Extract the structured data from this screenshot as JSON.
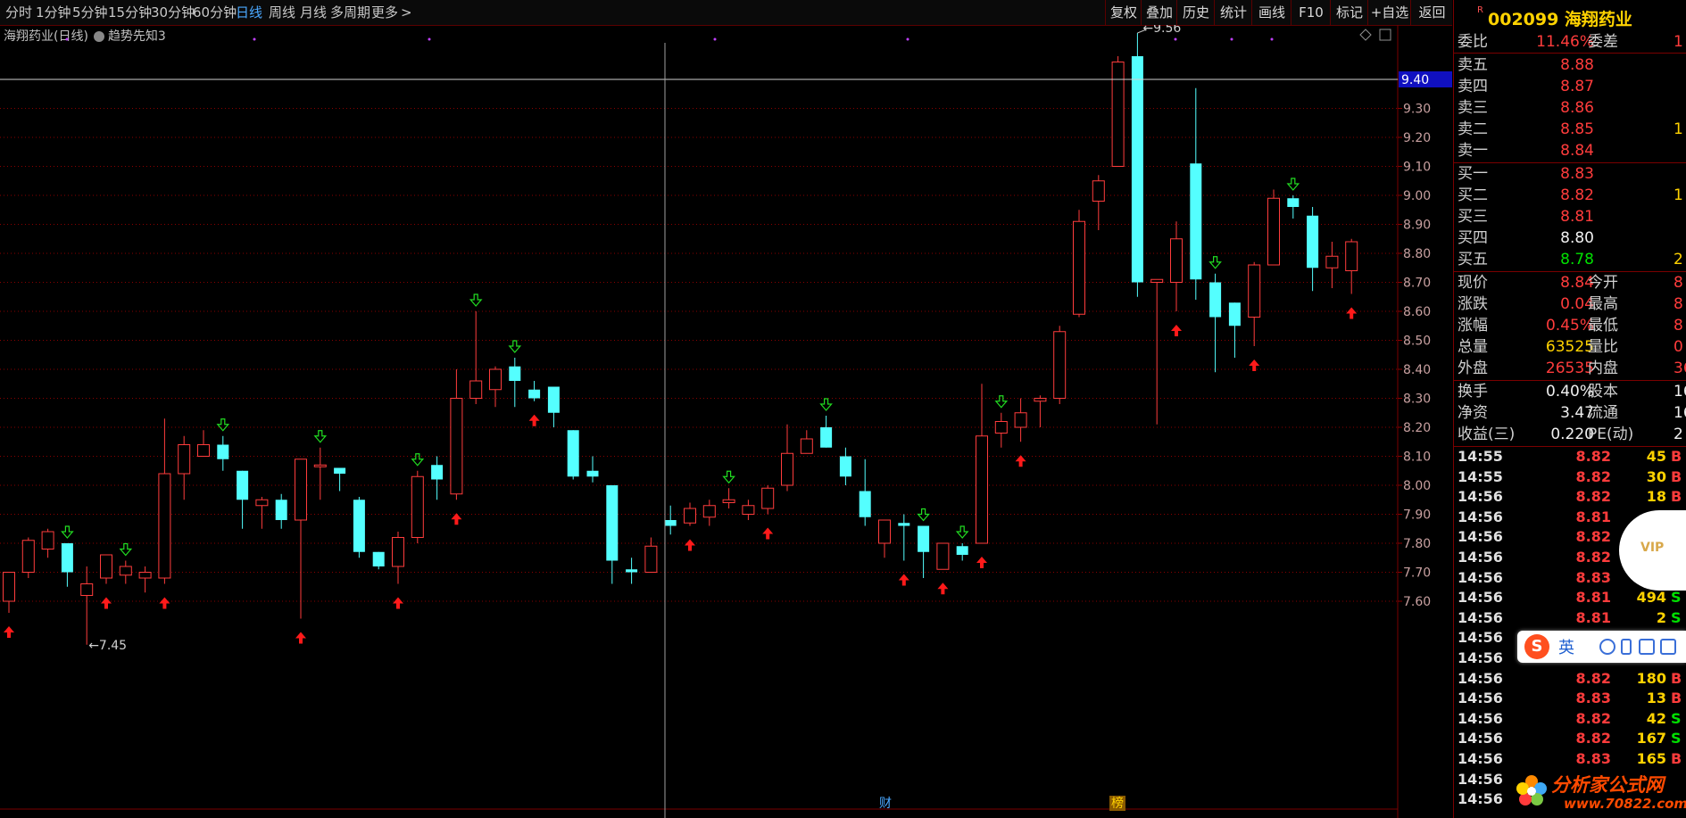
{
  "toolbar": {
    "periods": [
      "分时",
      "1分钟",
      "5分钟",
      "15分钟",
      "30分钟",
      "60分钟",
      "日线",
      "周线",
      "月线",
      "多周期",
      "更多"
    ],
    "active_period": "日线",
    "more_arrow": ">",
    "right_buttons": [
      "复权",
      "叠加",
      "历史",
      "统计",
      "画线",
      "F10",
      "标记",
      "+自选",
      "返回"
    ]
  },
  "chart": {
    "stock_title": "海翔药业(日线)",
    "indicator": "趋势先知3",
    "crosshair_price": "9.40",
    "high_label": "9.56",
    "low_label": "7.45",
    "markers": [
      "财",
      "榜"
    ],
    "icons": [
      "diamond-icon",
      "window-icon"
    ]
  },
  "chart_data": {
    "type": "candlestick",
    "y_ticks": [
      "9.40",
      "9.30",
      "9.20",
      "9.10",
      "9.00",
      "8.90",
      "8.80",
      "8.70",
      "8.60",
      "8.50",
      "8.40",
      "8.30",
      "8.20",
      "8.10",
      "8.00",
      "7.90",
      "7.80",
      "7.70",
      "7.60"
    ],
    "ylim": [
      7.4,
      9.6
    ],
    "up_color": "#ff3c3c",
    "down_color": "#54ffff",
    "candles": [
      {
        "o": 7.6,
        "h": 7.7,
        "l": 7.56,
        "c": 7.7
      },
      {
        "o": 7.7,
        "h": 7.82,
        "l": 7.68,
        "c": 7.81
      },
      {
        "o": 7.78,
        "h": 7.85,
        "l": 7.75,
        "c": 7.84
      },
      {
        "o": 7.8,
        "h": 7.8,
        "l": 7.65,
        "c": 7.7
      },
      {
        "o": 7.62,
        "h": 7.72,
        "l": 7.45,
        "c": 7.66
      },
      {
        "o": 7.68,
        "h": 7.76,
        "l": 7.66,
        "c": 7.76
      },
      {
        "o": 7.69,
        "h": 7.74,
        "l": 7.66,
        "c": 7.72
      },
      {
        "o": 7.68,
        "h": 7.72,
        "l": 7.63,
        "c": 7.7
      },
      {
        "o": 7.68,
        "h": 8.23,
        "l": 7.66,
        "c": 8.04
      },
      {
        "o": 8.04,
        "h": 8.17,
        "l": 7.95,
        "c": 8.14
      },
      {
        "o": 8.1,
        "h": 8.19,
        "l": 8.1,
        "c": 8.14
      },
      {
        "o": 8.14,
        "h": 8.17,
        "l": 8.05,
        "c": 8.09
      },
      {
        "o": 8.05,
        "h": 8.05,
        "l": 7.85,
        "c": 7.95
      },
      {
        "o": 7.93,
        "h": 7.96,
        "l": 7.85,
        "c": 7.95
      },
      {
        "o": 7.95,
        "h": 7.97,
        "l": 7.85,
        "c": 7.88
      },
      {
        "o": 7.88,
        "h": 8.09,
        "l": 7.54,
        "c": 8.09
      },
      {
        "o": 8.07,
        "h": 8.13,
        "l": 7.95,
        "c": 8.07
      },
      {
        "o": 8.06,
        "h": 8.06,
        "l": 7.98,
        "c": 8.04
      },
      {
        "o": 7.95,
        "h": 7.96,
        "l": 7.75,
        "c": 7.77
      },
      {
        "o": 7.77,
        "h": 7.77,
        "l": 7.71,
        "c": 7.72
      },
      {
        "o": 7.72,
        "h": 7.84,
        "l": 7.66,
        "c": 7.82
      },
      {
        "o": 7.82,
        "h": 8.05,
        "l": 7.8,
        "c": 8.03
      },
      {
        "o": 8.07,
        "h": 8.1,
        "l": 7.95,
        "c": 8.02
      },
      {
        "o": 7.97,
        "h": 8.4,
        "l": 7.95,
        "c": 8.3
      },
      {
        "o": 8.3,
        "h": 8.6,
        "l": 8.28,
        "c": 8.36
      },
      {
        "o": 8.33,
        "h": 8.41,
        "l": 8.27,
        "c": 8.4
      },
      {
        "o": 8.41,
        "h": 8.44,
        "l": 8.27,
        "c": 8.36
      },
      {
        "o": 8.33,
        "h": 8.36,
        "l": 8.29,
        "c": 8.3
      },
      {
        "o": 8.34,
        "h": 8.34,
        "l": 8.2,
        "c": 8.25
      },
      {
        "o": 8.19,
        "h": 8.19,
        "l": 8.02,
        "c": 8.03
      },
      {
        "o": 8.05,
        "h": 8.1,
        "l": 8.01,
        "c": 8.03
      },
      {
        "o": 8.0,
        "h": 8.0,
        "l": 7.66,
        "c": 7.74
      },
      {
        "o": 7.71,
        "h": 7.75,
        "l": 7.66,
        "c": 7.7
      },
      {
        "o": 7.7,
        "h": 7.82,
        "l": 7.7,
        "c": 7.79
      },
      {
        "o": 7.88,
        "h": 7.93,
        "l": 7.83,
        "c": 7.86
      },
      {
        "o": 7.87,
        "h": 7.94,
        "l": 7.86,
        "c": 7.92
      },
      {
        "o": 7.89,
        "h": 7.95,
        "l": 7.86,
        "c": 7.93
      },
      {
        "o": 7.94,
        "h": 7.99,
        "l": 7.92,
        "c": 7.95
      },
      {
        "o": 7.9,
        "h": 7.95,
        "l": 7.88,
        "c": 7.93
      },
      {
        "o": 7.92,
        "h": 8.0,
        "l": 7.9,
        "c": 7.99
      },
      {
        "o": 8.0,
        "h": 8.21,
        "l": 7.98,
        "c": 8.11
      },
      {
        "o": 8.11,
        "h": 8.19,
        "l": 8.13,
        "c": 8.16
      },
      {
        "o": 8.2,
        "h": 8.24,
        "l": 8.13,
        "c": 8.13
      },
      {
        "o": 8.1,
        "h": 8.13,
        "l": 8.0,
        "c": 8.03
      },
      {
        "o": 7.98,
        "h": 8.09,
        "l": 7.86,
        "c": 7.89
      },
      {
        "o": 7.8,
        "h": 7.88,
        "l": 7.75,
        "c": 7.88
      },
      {
        "o": 7.87,
        "h": 7.9,
        "l": 7.74,
        "c": 7.86
      },
      {
        "o": 7.86,
        "h": 7.86,
        "l": 7.68,
        "c": 7.77
      },
      {
        "o": 7.71,
        "h": 7.8,
        "l": 7.71,
        "c": 7.8
      },
      {
        "o": 7.79,
        "h": 7.8,
        "l": 7.74,
        "c": 7.76
      },
      {
        "o": 7.8,
        "h": 8.35,
        "l": 7.8,
        "c": 8.17
      },
      {
        "o": 8.18,
        "h": 8.25,
        "l": 8.13,
        "c": 8.22
      },
      {
        "o": 8.2,
        "h": 8.3,
        "l": 8.15,
        "c": 8.25
      },
      {
        "o": 8.29,
        "h": 8.31,
        "l": 8.2,
        "c": 8.3
      },
      {
        "o": 8.3,
        "h": 8.55,
        "l": 8.28,
        "c": 8.53
      },
      {
        "o": 8.59,
        "h": 8.95,
        "l": 8.58,
        "c": 8.91
      },
      {
        "o": 8.98,
        "h": 9.07,
        "l": 8.88,
        "c": 9.05
      },
      {
        "o": 9.1,
        "h": 9.48,
        "l": 9.1,
        "c": 9.46
      },
      {
        "o": 9.48,
        "h": 9.56,
        "l": 8.65,
        "c": 8.7
      },
      {
        "o": 8.7,
        "h": 8.71,
        "l": 8.21,
        "c": 8.71
      },
      {
        "o": 8.7,
        "h": 8.91,
        "l": 8.6,
        "c": 8.85
      },
      {
        "o": 9.11,
        "h": 9.37,
        "l": 8.64,
        "c": 8.71
      },
      {
        "o": 8.7,
        "h": 8.73,
        "l": 8.39,
        "c": 8.58
      },
      {
        "o": 8.63,
        "h": 8.63,
        "l": 8.44,
        "c": 8.55
      },
      {
        "o": 8.58,
        "h": 8.77,
        "l": 8.48,
        "c": 8.76
      },
      {
        "o": 8.76,
        "h": 9.02,
        "l": 8.76,
        "c": 8.99
      },
      {
        "o": 8.99,
        "h": 9.0,
        "l": 8.92,
        "c": 8.96
      },
      {
        "o": 8.93,
        "h": 8.96,
        "l": 8.67,
        "c": 8.75
      },
      {
        "o": 8.75,
        "h": 8.84,
        "l": 8.68,
        "c": 8.79
      },
      {
        "o": 8.74,
        "h": 8.85,
        "l": 8.66,
        "c": 8.84
      }
    ],
    "buy_arrows": [
      0,
      5,
      8,
      15,
      20,
      23,
      27,
      35,
      39,
      46,
      48,
      50,
      52,
      60,
      64,
      69
    ],
    "sell_arrows": [
      3,
      6,
      11,
      16,
      21,
      24,
      26,
      37,
      42,
      47,
      49,
      51,
      62,
      66
    ]
  },
  "panel": {
    "r_badge": "R",
    "code_title": "002099 海翔药业",
    "weibi": {
      "label": "委比",
      "value": "11.46%",
      "label2": "委差",
      "value2": "1"
    },
    "asks": [
      {
        "label": "卖五",
        "price": "8.88",
        "vol": ""
      },
      {
        "label": "卖四",
        "price": "8.87",
        "vol": ""
      },
      {
        "label": "卖三",
        "price": "8.86",
        "vol": ""
      },
      {
        "label": "卖二",
        "price": "8.85",
        "vol": "1"
      },
      {
        "label": "卖一",
        "price": "8.84",
        "vol": ""
      }
    ],
    "bids": [
      {
        "label": "买一",
        "price": "8.83",
        "vol": ""
      },
      {
        "label": "买二",
        "price": "8.82",
        "vol": "1"
      },
      {
        "label": "买三",
        "price": "8.81",
        "vol": ""
      },
      {
        "label": "买四",
        "price": "8.80",
        "vol": ""
      },
      {
        "label": "买五",
        "price": "8.78",
        "vol": "2"
      }
    ],
    "stats": [
      {
        "l1": "现价",
        "v1": "8.84",
        "c1": "red",
        "l2": "今开",
        "v2": "8"
      },
      {
        "l1": "涨跌",
        "v1": "0.04",
        "c1": "red",
        "l2": "最高",
        "v2": "8"
      },
      {
        "l1": "涨幅",
        "v1": "0.45%",
        "c1": "red",
        "l2": "最低",
        "v2": "8"
      },
      {
        "l1": "总量",
        "v1": "63525",
        "c1": "yellow",
        "l2": "量比",
        "v2": "0"
      },
      {
        "l1": "外盘",
        "v1": "26535",
        "c1": "red",
        "l2": "内盘",
        "v2": "36"
      }
    ],
    "fund": [
      {
        "l1": "换手",
        "v1": "0.40%",
        "l2": "股本",
        "v2": "16."
      },
      {
        "l1": "净资",
        "v1": "3.47",
        "l2": "流通",
        "v2": "16."
      },
      {
        "l1": "收益(三)",
        "v1": "0.220",
        "l2": "PE(动)",
        "v2": "2"
      }
    ],
    "ticks": [
      {
        "time": "14:55",
        "price": "8.82",
        "vol": "45",
        "side": "B"
      },
      {
        "time": "14:55",
        "price": "8.82",
        "vol": "30",
        "side": "B"
      },
      {
        "time": "14:56",
        "price": "8.82",
        "vol": "18",
        "side": "B"
      },
      {
        "time": "14:56",
        "price": "8.81",
        "vol": "",
        "side": ""
      },
      {
        "time": "14:56",
        "price": "8.82",
        "vol": "",
        "side": ""
      },
      {
        "time": "14:56",
        "price": "8.82",
        "vol": "",
        "side": ""
      },
      {
        "time": "14:56",
        "price": "8.83",
        "vol": "",
        "side": ""
      },
      {
        "time": "14:56",
        "price": "8.81",
        "vol": "494",
        "side": "S"
      },
      {
        "time": "14:56",
        "price": "8.81",
        "vol": "2",
        "side": "S"
      },
      {
        "time": "14:56",
        "price": "",
        "vol": "",
        "side": ""
      },
      {
        "time": "14:56",
        "price": "8.82",
        "vol": "",
        "side": "B"
      },
      {
        "time": "14:56",
        "price": "8.82",
        "vol": "180",
        "side": "B"
      },
      {
        "time": "14:56",
        "price": "8.83",
        "vol": "13",
        "side": "B"
      },
      {
        "time": "14:56",
        "price": "8.82",
        "vol": "42",
        "side": "S"
      },
      {
        "time": "14:56",
        "price": "8.82",
        "vol": "167",
        "side": "S"
      },
      {
        "time": "14:56",
        "price": "8.83",
        "vol": "165",
        "side": "B"
      },
      {
        "time": "14:56",
        "price": "",
        "vol": "",
        "side": ""
      },
      {
        "time": "14:56",
        "price": "",
        "vol": "",
        "side": ""
      }
    ]
  },
  "overlays": {
    "ime_label": "英",
    "ime_logo": "S",
    "vip_label": "VIP",
    "logo_title": "分析家公式网",
    "logo_url": "www.70822.com"
  }
}
